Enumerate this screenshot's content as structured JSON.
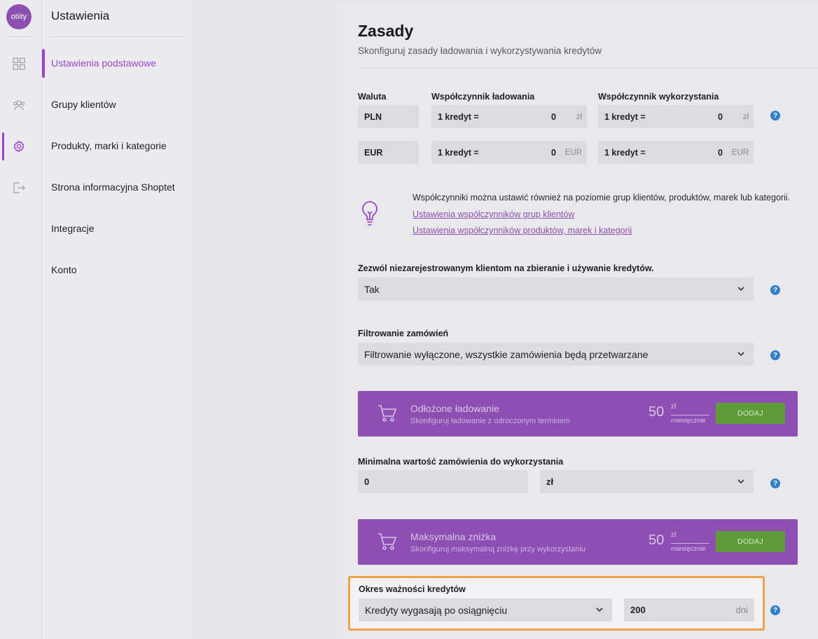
{
  "app": {
    "logo_text": "otiity"
  },
  "rail": {
    "icons": [
      "dashboard-icon",
      "users-icon",
      "settings-icon",
      "logout-icon"
    ]
  },
  "menu": {
    "title": "Ustawienia",
    "items": [
      {
        "label": "Ustawienia podstawowe"
      },
      {
        "label": "Grupy klientów"
      },
      {
        "label": "Produkty, marki i kategorie"
      },
      {
        "label": "Strona informacyjna Shoptet"
      },
      {
        "label": "Integracje"
      },
      {
        "label": "Konto"
      }
    ]
  },
  "page": {
    "title": "Zasady",
    "subtitle": "Skonfiguruj zasady ładowania i wykorzystywania kredytów"
  },
  "rates": {
    "col_currency": "Waluta",
    "col_load": "Współczynnik ładowania",
    "col_use": "Współczynnik wykorzystania",
    "rows": [
      {
        "currency": "PLN",
        "load_prefix": "1 kredyt =",
        "load_value": "0",
        "load_unit": "zł",
        "use_prefix": "1 kredyt =",
        "use_value": "0",
        "use_unit": "zł"
      },
      {
        "currency": "EUR",
        "load_prefix": "1 kredyt =",
        "load_value": "0",
        "load_unit": "EUR",
        "use_prefix": "1 kredyt =",
        "use_value": "0",
        "use_unit": "EUR"
      }
    ]
  },
  "hint": {
    "text": "Współczynniki można ustawić również na poziomie grup klientów, produktów, marek lub kategorii.",
    "link1": "Ustawienia współczynników grup klientów",
    "link2": "Ustawienia współczynników produktów, marek i kategorii"
  },
  "unregistered": {
    "label": "Zezwól niezarejestrowanym klientom na zbieranie i używanie kredytów.",
    "value": "Tak"
  },
  "filter": {
    "label": "Filtrowanie zamówień",
    "value": "Filtrowanie wyłączone, wszystkie zamówienia będą przetwarzane"
  },
  "promo1": {
    "title": "Odłożone ładowanie",
    "subtitle": "Skonfiguruj ładowanie z odroczonym terminem",
    "price": "50",
    "currency": "zł",
    "period": "miesięcznie",
    "button": "DODAJ"
  },
  "minorder": {
    "label": "Minimalna wartość zamówienia do wykorzystania",
    "value": "0",
    "currency": "zł"
  },
  "promo2": {
    "title": "Maksymalna zniżka",
    "subtitle": "Skonfiguruj maksymalną zniżkę przy wykorzystaniu",
    "price": "50",
    "currency": "zł",
    "period": "miesięcznie",
    "button": "DODAJ"
  },
  "validity": {
    "label": "Okres ważności kredytów",
    "mode": "Kredyty wygasają po osiągnięciu",
    "value": "200",
    "unit": "dni"
  },
  "help_glyph": "?",
  "colors": {
    "accent": "#9b45c6",
    "promo": "#8d4fb4",
    "add_button": "#5e9c3a",
    "help": "#2f7fcc",
    "highlight": "#f0a24a"
  }
}
